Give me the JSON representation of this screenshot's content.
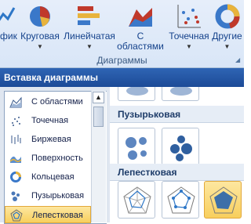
{
  "ribbon": {
    "buttons": [
      {
        "label": "фик"
      },
      {
        "label": "Круговая"
      },
      {
        "label": "Линейчатая"
      },
      {
        "label_line1": "С",
        "label_line2": "областями"
      },
      {
        "label": "Точечная"
      },
      {
        "label": "Другие"
      }
    ],
    "group_label": "Диаграммы"
  },
  "dialog": {
    "title": "Вставка диаграммы",
    "chart_types": [
      {
        "label": "С областями",
        "icon": "area-chart-icon"
      },
      {
        "label": "Точечная",
        "icon": "scatter-chart-icon"
      },
      {
        "label": "Биржевая",
        "icon": "stock-chart-icon"
      },
      {
        "label": "Поверхность",
        "icon": "surface-chart-icon"
      },
      {
        "label": "Кольцевая",
        "icon": "doughnut-chart-icon"
      },
      {
        "label": "Пузырьковая",
        "icon": "bubble-chart-icon"
      },
      {
        "label": "Лепестковая",
        "icon": "radar-chart-icon",
        "selected": true
      }
    ],
    "sections": [
      {
        "title": "Пузырьковая"
      },
      {
        "title": "Лепестковая"
      }
    ]
  }
}
